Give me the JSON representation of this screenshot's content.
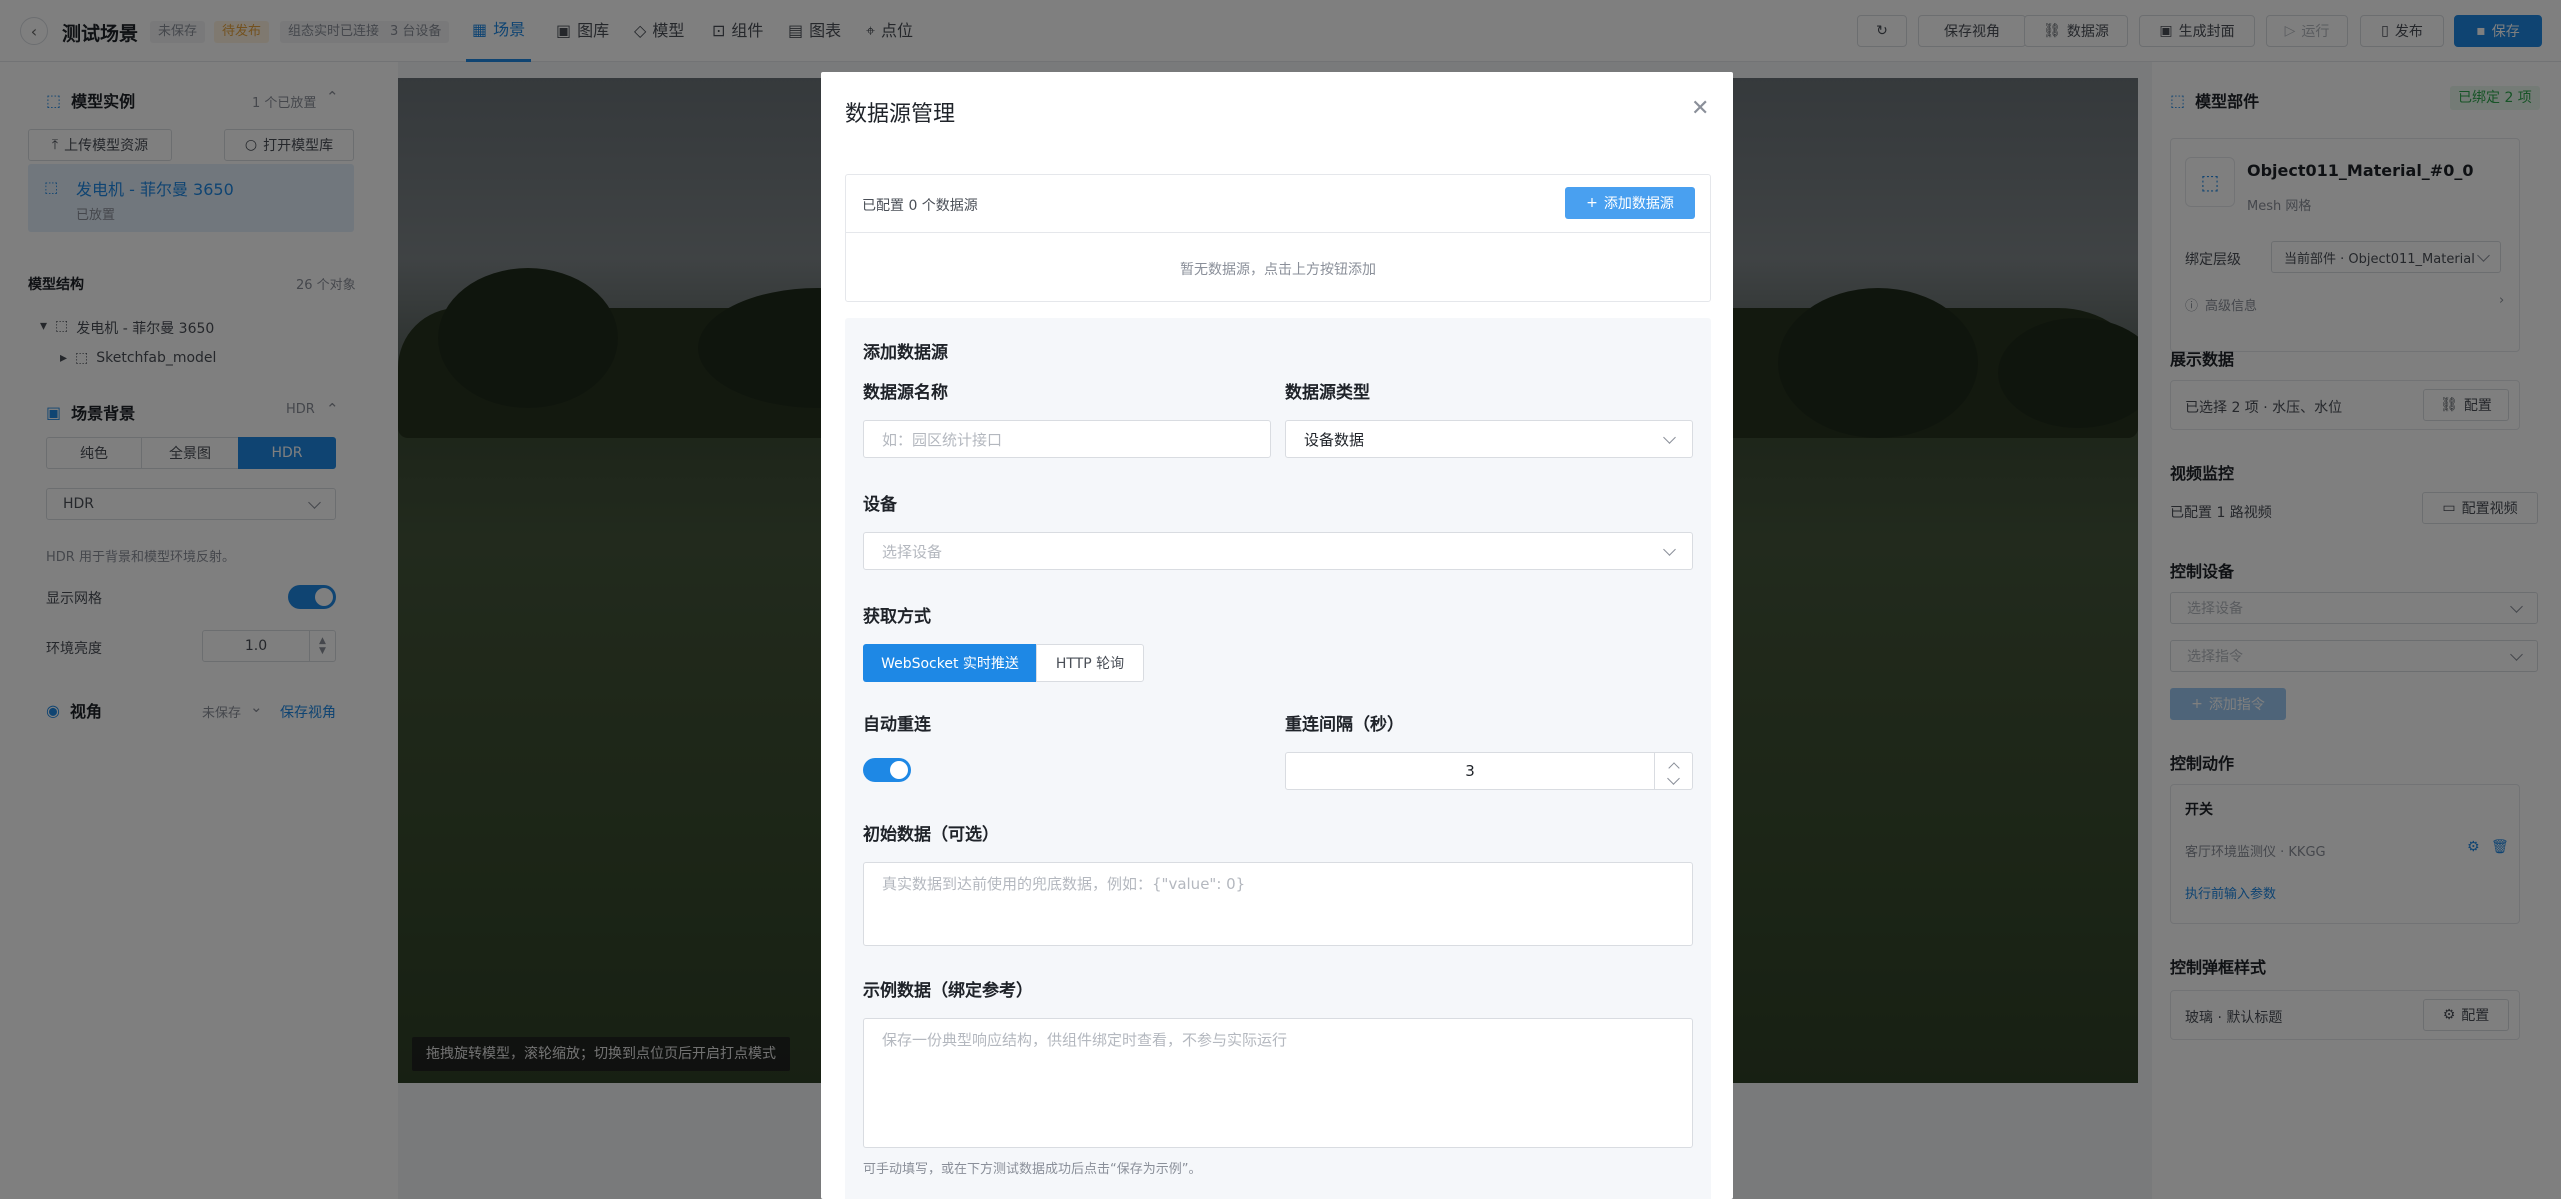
{
  "header": {
    "title": "测试场景",
    "tags": [
      "未保存",
      "待发布",
      "组态实时已连接",
      "3 台设备"
    ],
    "nav_tabs": [
      "场景",
      "图库",
      "模型",
      "组件",
      "图表",
      "点位"
    ],
    "buttons": {
      "refresh": "",
      "save_view": "保存视角",
      "datasource": "数据源",
      "cover": "生成封面",
      "run": "运行",
      "publish": "发布",
      "save": "保存"
    }
  },
  "left": {
    "model_instance": {
      "title": "模型实例",
      "count": "1 个已放置"
    },
    "upload_btn": "上传模型资源",
    "open_lib_btn": "打开模型库",
    "model_card": {
      "name": "发电机 - 菲尔曼 3650",
      "status": "已放置"
    },
    "structure": {
      "title": "模型结构",
      "count": "26 个对象",
      "root": "发电机 - 菲尔曼 3650",
      "child": "Sketchfab_model"
    },
    "background": {
      "title": "场景背景",
      "mode": "HDR",
      "segments": [
        "纯色",
        "全景图",
        "HDR"
      ],
      "select": "HDR",
      "hint": "HDR 用于背景和模型环境反射。"
    },
    "show_grid": "显示网格",
    "env_brightness": {
      "label": "环境亮度",
      "value": "1.0"
    },
    "view": {
      "title": "视角",
      "status": "未保存",
      "save_link": "保存视角"
    }
  },
  "viewport": {
    "hint": "拖拽旋转模型，滚轮缩放；切换到点位页后开启打点模式"
  },
  "right": {
    "parts_title": "模型部件",
    "bound_badge": "已绑定 2 项",
    "part": {
      "name": "Object011_Material_#0_0",
      "type": "Mesh 网格"
    },
    "bind_level": {
      "label": "绑定层级",
      "value": "当前部件 · Object011_Material"
    },
    "advanced": "高级信息",
    "display_data": {
      "title": "展示数据",
      "text": "已选择 2 项 · 水压、水位",
      "btn": "配置"
    },
    "video": {
      "title": "视频监控",
      "text": "已配置 1 路视频",
      "btn": "配置视频"
    },
    "control_device": {
      "title": "控制设备",
      "device_placeholder": "选择设备",
      "cmd_placeholder": "选择指令",
      "add_btn": "添加指令"
    },
    "control_action": {
      "title": "控制动作",
      "switch": "开关",
      "device": "客厅环境监测仪 · KKGG",
      "link": "执行前输入参数"
    },
    "style": {
      "title": "控制弹框样式",
      "text": "玻璃 · 默认标题",
      "btn": "配置"
    }
  },
  "modal": {
    "title": "数据源管理",
    "configured": "已配置 0 个数据源",
    "add_btn": "添加数据源",
    "empty": "暂无数据源，点击上方按钮添加",
    "section": "添加数据源",
    "name_label": "数据源名称",
    "name_placeholder": "如：园区统计接口",
    "type_label": "数据源类型",
    "type_value": "设备数据",
    "device_label": "设备",
    "device_placeholder": "选择设备",
    "method_label": "获取方式",
    "method_ws": "WebSocket 实时推送",
    "method_http": "HTTP 轮询",
    "reconnect_label": "自动重连",
    "interval_label": "重连间隔（秒）",
    "interval_value": "3",
    "init_label": "初始数据（可选）",
    "init_placeholder": "真实数据到达前使用的兜底数据，例如：{\"value\": 0}",
    "sample_label": "示例数据（绑定参考）",
    "sample_placeholder": "保存一份典型响应结构，供组件绑定时查看，不参与实际运行",
    "sample_hint": "可手动填写，或在下方测试数据成功后点击“保存为示例”。"
  }
}
